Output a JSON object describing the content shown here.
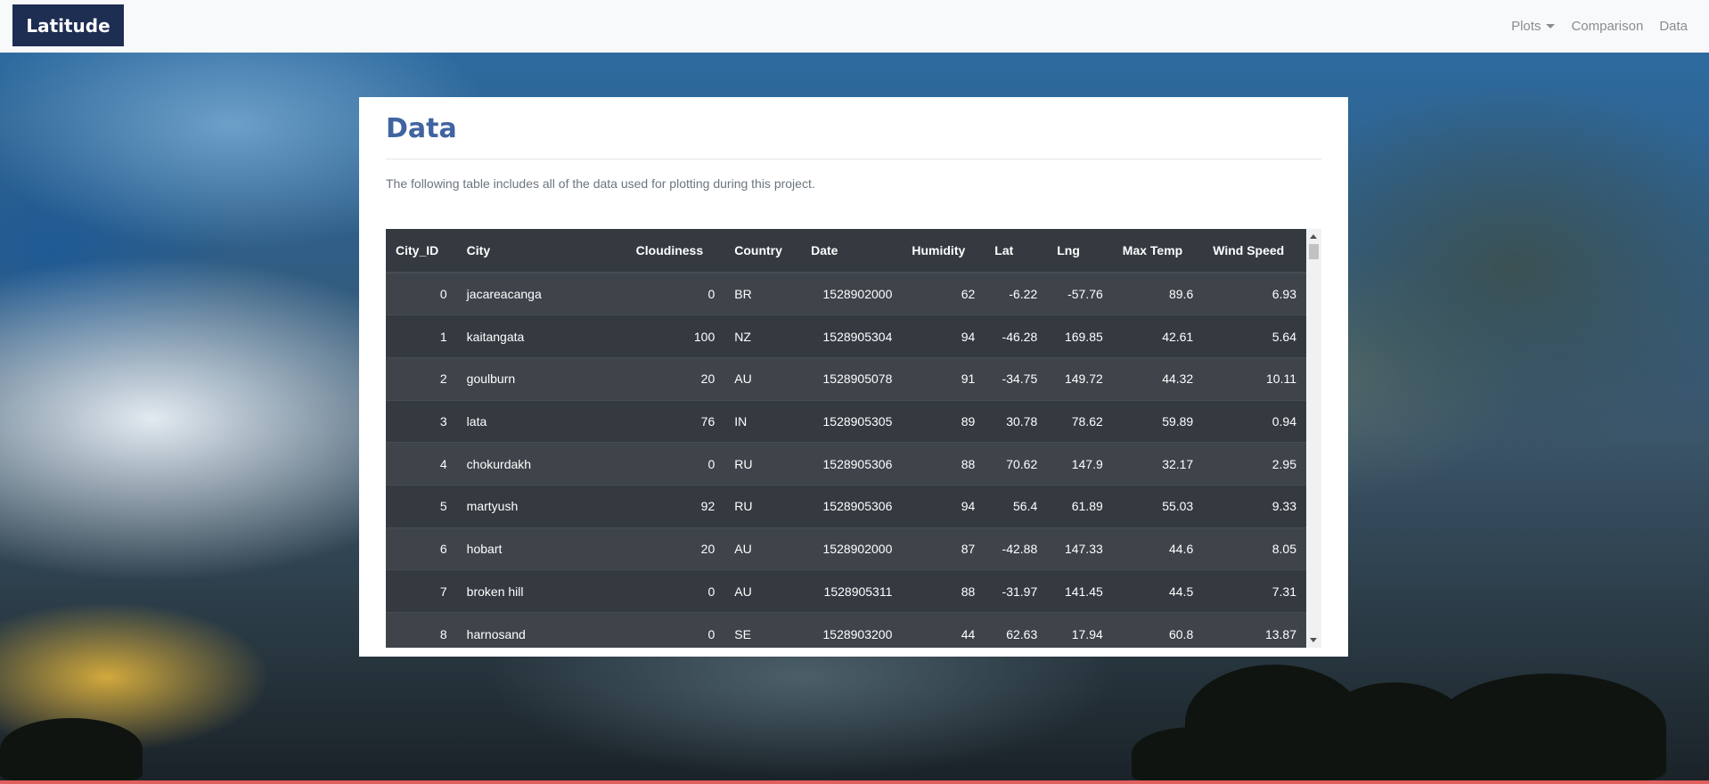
{
  "navbar": {
    "brand": "Latitude",
    "links": [
      {
        "label": "Plots"
      },
      {
        "label": "Comparison"
      },
      {
        "label": "Data"
      }
    ]
  },
  "main": {
    "title": "Data",
    "description": "The following table includes all of the data used for plotting during this project."
  },
  "table": {
    "columns": [
      "City_ID",
      "City",
      "Cloudiness",
      "Country",
      "Date",
      "Humidity",
      "Lat",
      "Lng",
      "Max Temp",
      "Wind Speed"
    ],
    "rows": [
      [
        "0",
        "jacareacanga",
        "0",
        "BR",
        "1528902000",
        "62",
        "-6.22",
        "-57.76",
        "89.6",
        "6.93"
      ],
      [
        "1",
        "kaitangata",
        "100",
        "NZ",
        "1528905304",
        "94",
        "-46.28",
        "169.85",
        "42.61",
        "5.64"
      ],
      [
        "2",
        "goulburn",
        "20",
        "AU",
        "1528905078",
        "91",
        "-34.75",
        "149.72",
        "44.32",
        "10.11"
      ],
      [
        "3",
        "lata",
        "76",
        "IN",
        "1528905305",
        "89",
        "30.78",
        "78.62",
        "59.89",
        "0.94"
      ],
      [
        "4",
        "chokurdakh",
        "0",
        "RU",
        "1528905306",
        "88",
        "70.62",
        "147.9",
        "32.17",
        "2.95"
      ],
      [
        "5",
        "martyush",
        "92",
        "RU",
        "1528905306",
        "94",
        "56.4",
        "61.89",
        "55.03",
        "9.33"
      ],
      [
        "6",
        "hobart",
        "20",
        "AU",
        "1528902000",
        "87",
        "-42.88",
        "147.33",
        "44.6",
        "8.05"
      ],
      [
        "7",
        "broken hill",
        "0",
        "AU",
        "1528905311",
        "88",
        "-31.97",
        "141.45",
        "44.5",
        "7.31"
      ],
      [
        "8",
        "harnosand",
        "0",
        "SE",
        "1528903200",
        "44",
        "62.63",
        "17.94",
        "60.8",
        "13.87"
      ]
    ]
  },
  "colors": {
    "brand_bg": "#1e2d52",
    "title": "#3f64a0",
    "table_bg": "#343a40",
    "table_stripe": "#3e444a",
    "bottom_strip": "#e0605e"
  },
  "icons": {
    "dropdown": "caret-down-icon"
  }
}
